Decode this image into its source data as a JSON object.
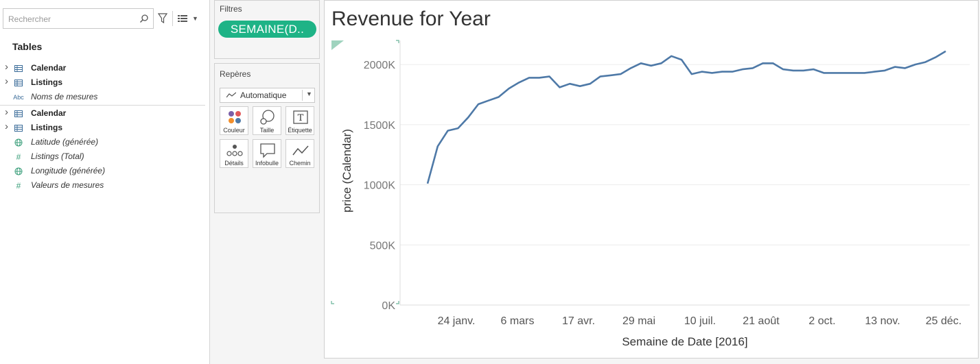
{
  "search": {
    "placeholder": "Rechercher"
  },
  "data_pane": {
    "tables_title": "Tables",
    "fields": [
      {
        "label": "Calendar",
        "style": "bold",
        "icon": "table-icon",
        "expandable": true
      },
      {
        "label": "Listings",
        "style": "bold",
        "icon": "table-icon",
        "expandable": true
      },
      {
        "label": "Noms de mesures",
        "style": "italic",
        "icon": "abc-icon",
        "icon_text": "Abc",
        "expandable": false
      },
      {
        "divider": true
      },
      {
        "label": "Calendar",
        "style": "bold",
        "icon": "table-icon",
        "expandable": true
      },
      {
        "label": "Listings",
        "style": "bold",
        "icon": "table-icon",
        "expandable": true
      },
      {
        "label": "Latitude (générée)",
        "style": "italic",
        "icon": "globe-icon",
        "expandable": false
      },
      {
        "label": "Listings (Total)",
        "style": "italic",
        "icon": "hash-icon",
        "icon_text": "#",
        "expandable": false
      },
      {
        "label": "Longitude (générée)",
        "style": "italic",
        "icon": "globe-icon",
        "expandable": false
      },
      {
        "label": "Valeurs de mesures",
        "style": "italic",
        "icon": "hash-icon",
        "icon_text": "#",
        "expandable": false
      }
    ]
  },
  "filters": {
    "title": "Filtres",
    "pill": "SEMAINE(D.."
  },
  "marks": {
    "title": "Repères",
    "type": "Automatique",
    "buttons": [
      {
        "label": "Couleur",
        "icon": "color-icon"
      },
      {
        "label": "Taille",
        "icon": "size-icon"
      },
      {
        "label": "Étiquette",
        "icon": "label-icon"
      },
      {
        "label": "Détails",
        "icon": "detail-icon"
      },
      {
        "label": "Infobulle",
        "icon": "tooltip-icon"
      },
      {
        "label": "Chemin",
        "icon": "path-icon"
      }
    ]
  },
  "colors": {
    "line": "#4e79a7",
    "pill": "#1eb386"
  },
  "chart_data": {
    "type": "line",
    "title": "Revenue for Year",
    "xlabel": "Semaine de Date [2016]",
    "ylabel": "price (Calendar)",
    "ylim": [
      0,
      2200000
    ],
    "yticks": [
      0,
      500000,
      1000000,
      1500000,
      2000000
    ],
    "ytick_labels": [
      "0K",
      "500K",
      "1000K",
      "1500K",
      "2000K"
    ],
    "xtick_labels": [
      "24 janv.",
      "6 mars",
      "17 avr.",
      "29 mai",
      "10 juil.",
      "21 août",
      "2 oct.",
      "13 nov.",
      "25 déc."
    ],
    "grid": true,
    "series": [
      {
        "values": [
          1010000,
          1320000,
          1450000,
          1470000,
          1560000,
          1670000,
          1700000,
          1730000,
          1800000,
          1850000,
          1890000,
          1890000,
          1900000,
          1810000,
          1840000,
          1820000,
          1840000,
          1900000,
          1910000,
          1920000,
          1970000,
          2010000,
          1990000,
          2010000,
          2070000,
          2040000,
          1920000,
          1940000,
          1930000,
          1940000,
          1940000,
          1960000,
          1970000,
          2010000,
          2010000,
          1960000,
          1950000,
          1950000,
          1960000,
          1930000,
          1930000,
          1930000,
          1930000,
          1930000,
          1940000,
          1950000,
          1980000,
          1970000,
          2000000,
          2020000,
          2060000,
          2110000
        ]
      }
    ]
  }
}
